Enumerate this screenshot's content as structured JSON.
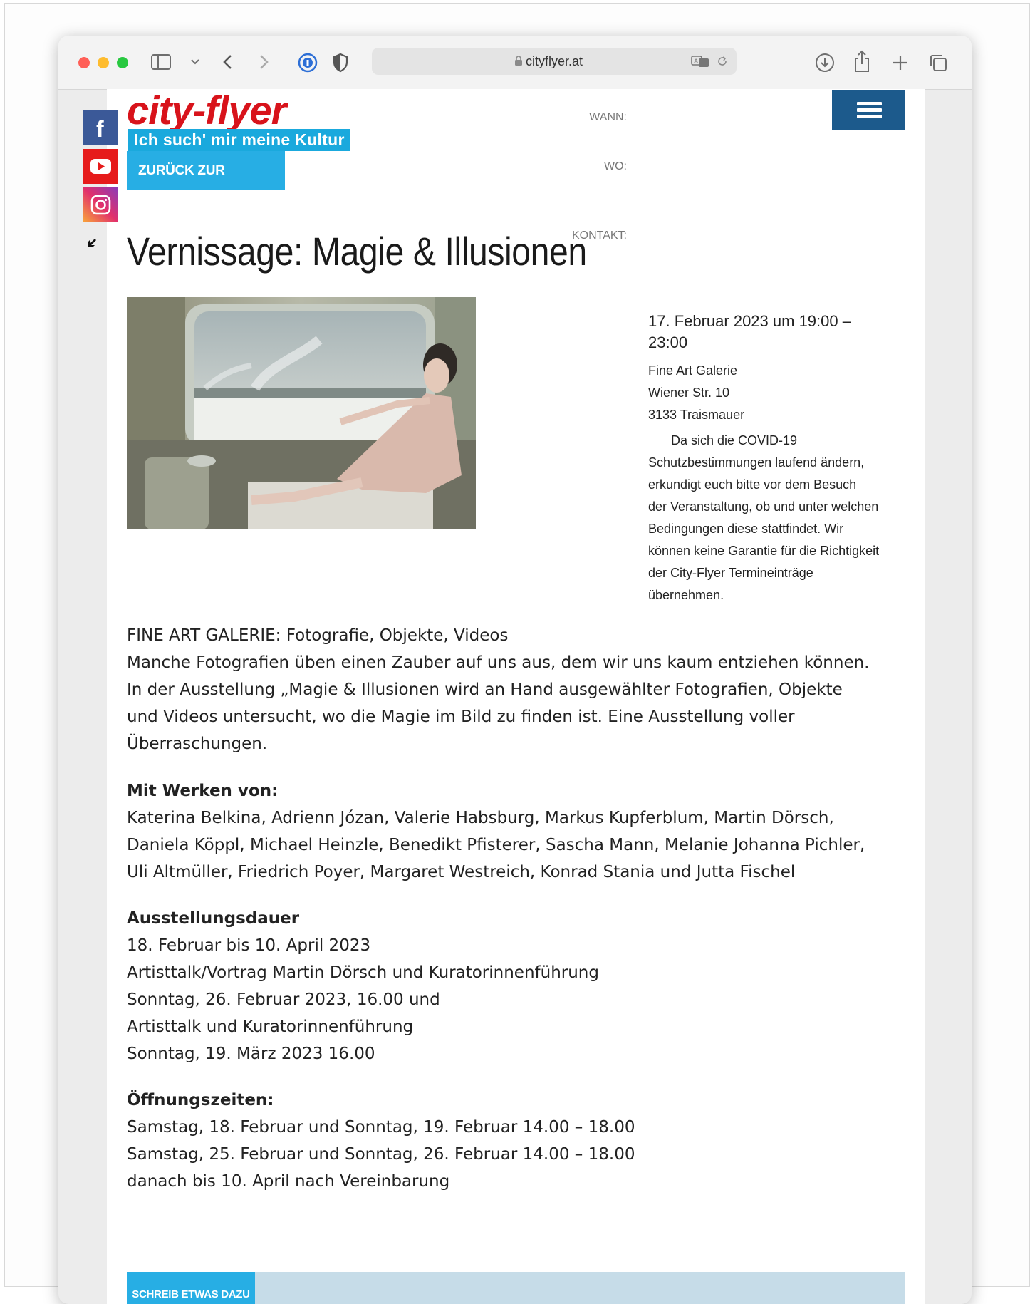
{
  "browser": {
    "url": "cityflyer.at",
    "colors": {
      "close": "#ff5f57",
      "minimize": "#febc2e",
      "zoom": "#28c840"
    },
    "icons": [
      "sidebar-icon",
      "chevron-down-icon",
      "back-icon",
      "forward-icon",
      "password-icon",
      "shield-icon",
      "lock-icon",
      "translate-icon",
      "reload-icon",
      "download-icon",
      "share-icon",
      "new-tab-icon",
      "tabs-icon"
    ]
  },
  "site": {
    "logo_text": "city-flyer",
    "tagline": "Ich such' mir meine Kultur",
    "back_label": "ZURÜCK ZUR AUSWAHL",
    "social_icons": [
      "facebook-icon",
      "youtube-icon",
      "instagram-icon",
      "collapse-arrow-icon"
    ],
    "brand_red": "#d8131b",
    "accent_blue": "#27aee4",
    "menu_blue": "#1c5a8c"
  },
  "event": {
    "title": "Vernissage: Magie & Illusionen",
    "labels": {
      "when": "WANN:",
      "where": "WO:",
      "contact": "KONTAKT:"
    },
    "when_lines": [
      "17. Februar 2023 um 19:00 –",
      "23:00"
    ],
    "where_lines": [
      "Fine Art Galerie",
      "Wiener Str. 10",
      "3133 Traismauer"
    ],
    "contact_lines": [
      "Da sich die COVID-19",
      "Schutzbestimmungen laufend ändern,",
      "erkundigt euch bitte vor dem Besuch",
      "der Veranstaltung, ob und unter welchen",
      "Bedingungen diese stattfindet. Wir",
      "können keine Garantie für die Richtigkeit",
      "der City-Flyer Termineinträge",
      "übernehmen."
    ]
  },
  "body": {
    "intro_lines": [
      "FINE ART GALERIE: Fotografie, Objekte, Videos",
      "Manche Fotografien üben einen Zauber auf uns aus, dem wir uns kaum entziehen können.",
      "In der Ausstellung „Magie & Illusionen wird an Hand ausgewählter Fotografien, Objekte",
      "und Videos untersucht, wo die Magie im Bild zu finden ist. Eine Ausstellung voller",
      "Überraschungen."
    ],
    "works_heading": "Mit Werken von:",
    "works_lines": [
      "Katerina Belkina, Adrienn Józan, Valerie Habsburg, Markus Kupferblum, Martin Dörsch,",
      "Daniela Köppl, Michael Heinzle, Benedikt Pfisterer, Sascha Mann, Melanie Johanna Pichler,",
      "Uli Altmüller, Friedrich Poyer, Margaret Westreich, Konrad Stania und Jutta Fischel"
    ],
    "duration_heading": "Ausstellungsdauer",
    "duration_lines": [
      "18. Februar bis 10. April 2023",
      "Artisttalk/Vortrag Martin Dörsch und Kuratorinnenführung",
      "Sonntag, 26. Februar 2023, 16.00 und",
      "Artisttalk und Kuratorinnenführung",
      "Sonntag, 19. März 2023 16.00"
    ],
    "hours_heading": "Öffnungszeiten:",
    "hours_lines": [
      "Samstag, 18. Februar und Sonntag, 19. Februar 14.00 – 18.00",
      "Samstag, 25. Februar und Sonntag, 26. Februar 14.00 – 18.00",
      "danach bis 10. April nach Vereinbarung"
    ]
  },
  "comment": {
    "button_label": "SCHREIB ETWAS DAZU"
  }
}
